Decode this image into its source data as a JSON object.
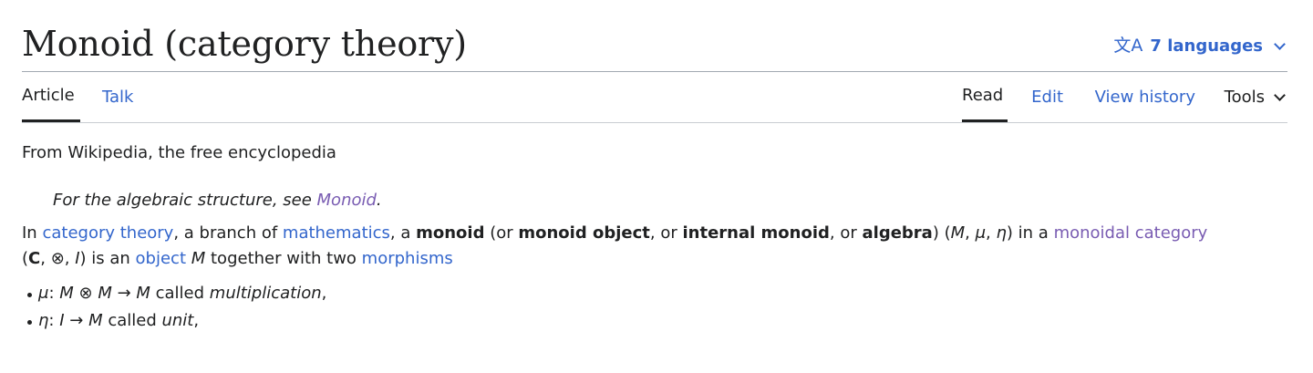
{
  "header": {
    "title": "Monoid (category theory)",
    "language_icon": "文A",
    "languages_label": "7 languages"
  },
  "tabs": {
    "article": "Article",
    "talk": "Talk",
    "read": "Read",
    "edit": "Edit",
    "view_history": "View history",
    "tools": "Tools"
  },
  "content": {
    "tagline": "From Wikipedia, the free encyclopedia",
    "hatnote": {
      "prefix": "For the algebraic structure, see ",
      "link": "Monoid",
      "suffix": "."
    },
    "intro": {
      "t1": "In ",
      "link_category_theory": "category theory",
      "t2": ", a branch of ",
      "link_mathematics": "mathematics",
      "t3": ", a ",
      "b_monoid": "monoid",
      "t4": " (or ",
      "b_monoid_object": "monoid object",
      "t5": ", or ",
      "b_internal_monoid": "internal monoid",
      "t6": ", or ",
      "b_algebra": "algebra",
      "t7": ") (",
      "m1": "M",
      "s1": ", ",
      "m2": "μ",
      "s2": ", ",
      "m3": "η",
      "t8": ") in a ",
      "link_monoidal_category": "monoidal category",
      "t9": "(",
      "bC": "C",
      "t10": ", ⊗, ",
      "iI": "I",
      "t11": ") is an ",
      "link_object": "object",
      "t12": " ",
      "iM": "M",
      "t13": " together with two ",
      "link_morphisms": "morphisms"
    },
    "bullets": [
      {
        "sym": "μ",
        "colon": ": ",
        "expr1": "M",
        "op": " ⊗ ",
        "expr2": "M",
        "arrow": " → ",
        "expr3": "M",
        "called": " called ",
        "name": "multiplication",
        "end": ","
      },
      {
        "sym": "η",
        "colon": ": ",
        "expr1": "I",
        "arrow": " → ",
        "expr3": "M",
        "called": " called ",
        "name": "unit",
        "end": ","
      }
    ]
  }
}
